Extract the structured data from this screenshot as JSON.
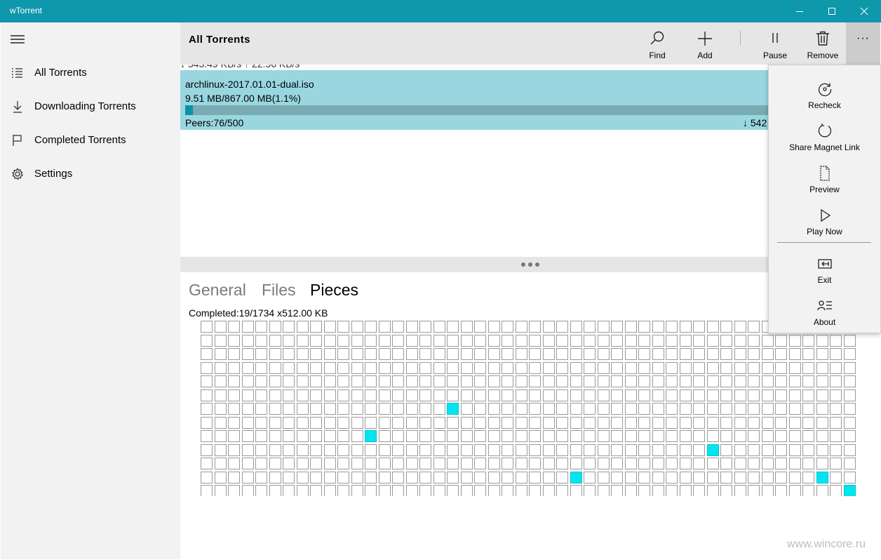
{
  "window": {
    "title": "wTorrent",
    "controls": {
      "minimize_icon": "minimize-icon",
      "maximize_icon": "maximize-icon",
      "close_icon": "close-icon"
    }
  },
  "sidebar": {
    "menu_icon": "hamburger-icon",
    "items": [
      {
        "label": "All Torrents",
        "icon": "list-icon"
      },
      {
        "label": "Downloading Torrents",
        "icon": "download-arrow-icon"
      },
      {
        "label": "Completed Torrents",
        "icon": "flag-icon"
      },
      {
        "label": "Settings",
        "icon": "gear-icon"
      }
    ]
  },
  "header": {
    "title": "All Torrents",
    "commands": [
      {
        "label": "Find",
        "icon": "search-icon"
      },
      {
        "label": "Add",
        "icon": "plus-icon"
      },
      {
        "label": "Pause",
        "icon": "pause-icon"
      },
      {
        "label": "Remove",
        "icon": "trash-icon"
      }
    ],
    "more_label": "···"
  },
  "overall_speed_clipped": "↓ 543.49 KB/s ↑ 22.56 KB/s",
  "torrent": {
    "name": "archlinux-2017.01.01-dual.iso",
    "size_text": "9.51 MB/867.00 MB(1.1%)",
    "progress_fraction": 0.011,
    "peers_text": "Peers:76/500",
    "speed_text": "↓ 542"
  },
  "detail_tabs": [
    {
      "label": "General",
      "active": false
    },
    {
      "label": "Files",
      "active": false
    },
    {
      "label": "Pieces",
      "active": true
    }
  ],
  "pieces": {
    "completed_text": "Completed:19/1734 x512.00 KB",
    "columns": 48,
    "visible_rows": 13,
    "done_cells": [
      [
        6,
        18
      ],
      [
        8,
        12
      ],
      [
        9,
        37
      ],
      [
        11,
        27
      ],
      [
        11,
        45
      ],
      [
        12,
        47
      ]
    ]
  },
  "flyout": {
    "items": [
      {
        "label": "Recheck",
        "icon": "recheck-icon"
      },
      {
        "label": "Share Magnet Link",
        "icon": "refresh-icon"
      },
      {
        "label": "Preview",
        "icon": "document-icon"
      },
      {
        "label": "Play Now",
        "icon": "play-icon"
      },
      {
        "label": "Exit",
        "icon": "exit-icon"
      },
      {
        "label": "About",
        "icon": "about-icon"
      }
    ]
  },
  "watermark": "www.wincore.ru",
  "colors": {
    "titlebar": "#0f97ac",
    "selected_row": "#99d6e0",
    "progress_fill": "#0a90a8",
    "piece_done": "#00e5f0"
  }
}
